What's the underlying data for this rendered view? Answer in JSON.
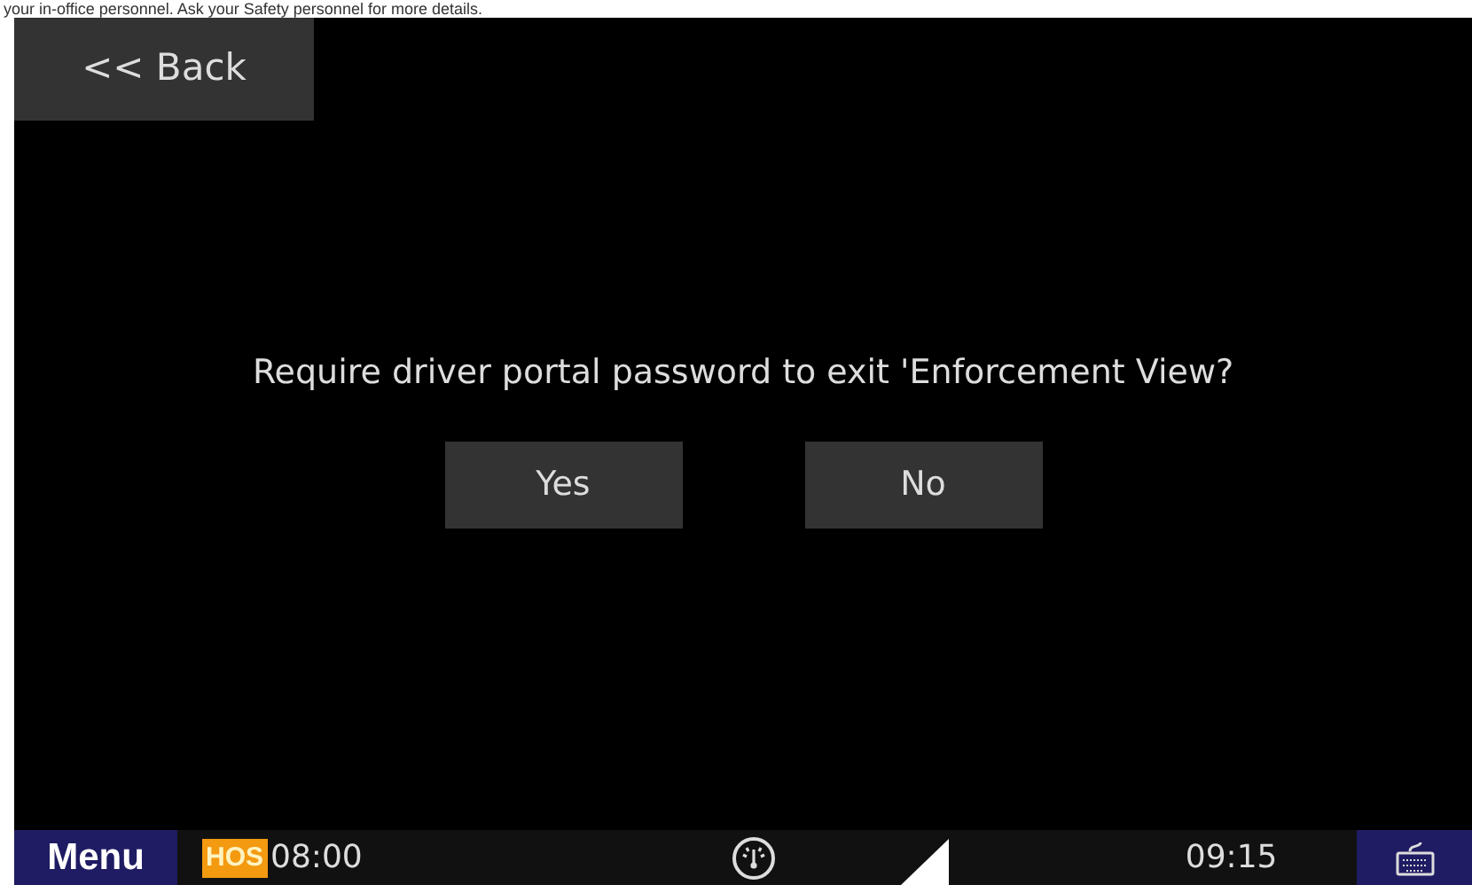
{
  "caption": "your in-office personnel. Ask your Safety personnel for more details.",
  "back_button": "<< Back",
  "dialog": {
    "question": "Require driver portal password to exit 'Enforcement View?",
    "buttons": [
      "Yes",
      "No"
    ]
  },
  "status_bar": {
    "menu": "Menu",
    "hos_badge": "HOS",
    "hos_time": "08:00",
    "clock": "09:15"
  }
}
